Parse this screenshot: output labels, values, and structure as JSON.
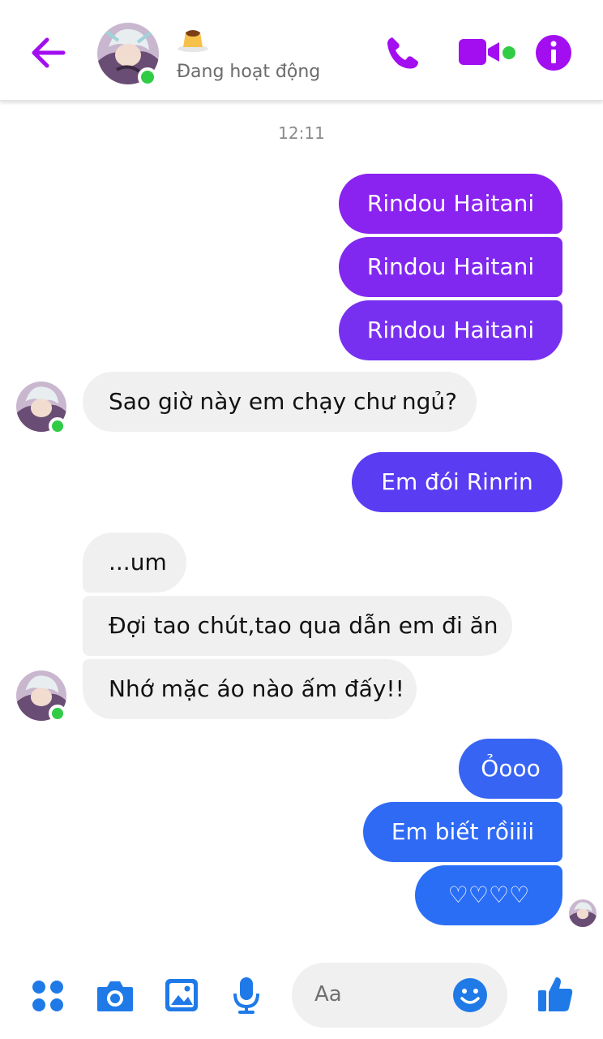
{
  "header": {
    "contact_name_emoji": "🍮",
    "status": "Đang hoạt động"
  },
  "conversation": {
    "timestamp": "12:11",
    "messages": [
      {
        "from": "me",
        "text": "Rindou Haitani"
      },
      {
        "from": "me",
        "text": "Rindou Haitani"
      },
      {
        "from": "me",
        "text": "Rindou Haitani"
      },
      {
        "from": "them",
        "text": "Sao giờ này em chạy chư ngủ?"
      },
      {
        "from": "me",
        "text": "Em đói Rinrin"
      },
      {
        "from": "them",
        "text": "...um"
      },
      {
        "from": "them",
        "text": "Đợi tao chút,tao qua dẫn em đi ăn"
      },
      {
        "from": "them",
        "text": "Nhớ mặc áo nào ấm đấy!!"
      },
      {
        "from": "me",
        "text": "Ỏooo"
      },
      {
        "from": "me",
        "text": "Em biết rồiiii"
      },
      {
        "from": "me",
        "text": "♡♡♡♡"
      }
    ]
  },
  "composer": {
    "placeholder": "Aa",
    "icons": [
      "apps-icon",
      "camera-icon",
      "image-icon",
      "microphone-icon",
      "emoji-icon",
      "thumbs-up-icon"
    ]
  },
  "colors": {
    "accent_purple": "#a20ef0",
    "bubble_purple": "#8a2ef0",
    "bubble_indigo": "#5d3cf2",
    "bubble_blue": "#2e6cf5",
    "composer_blue": "#1f7ae8",
    "online_green": "#31cc46",
    "received_bubble": "#f0f0f0"
  }
}
